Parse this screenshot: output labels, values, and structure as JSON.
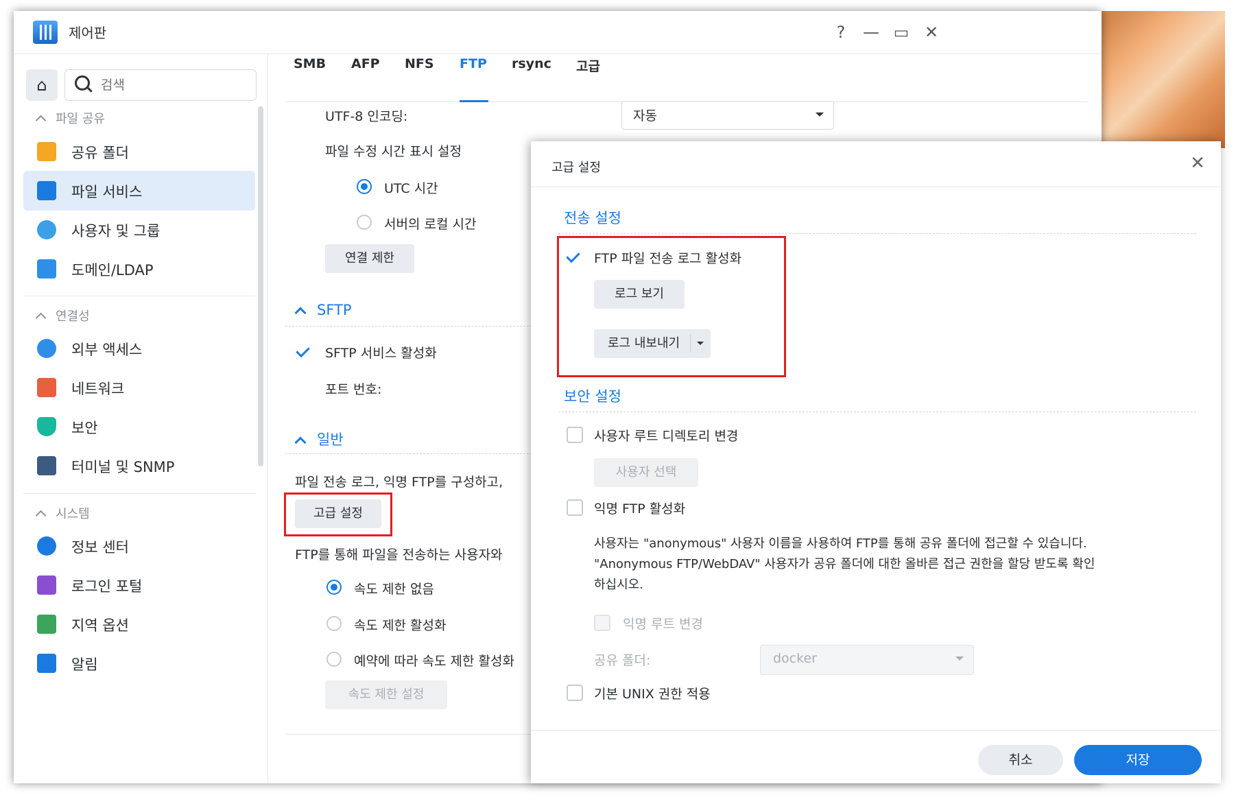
{
  "window": {
    "title": "제어판"
  },
  "window_buttons": {
    "help": "?",
    "minimize": "—",
    "maximize": "▭",
    "close": "✕"
  },
  "sidebar": {
    "search_placeholder": "검색",
    "sections": [
      {
        "title": "파일 공유",
        "items": [
          {
            "label": "공유 폴더",
            "icon": "folder-icon"
          },
          {
            "label": "파일 서비스",
            "icon": "file-services-icon",
            "active": true
          },
          {
            "label": "사용자 및 그룹",
            "icon": "users-icon"
          },
          {
            "label": "도메인/LDAP",
            "icon": "domain-icon"
          }
        ]
      },
      {
        "title": "연결성",
        "items": [
          {
            "label": "외부 액세스",
            "icon": "external-access-icon"
          },
          {
            "label": "네트워크",
            "icon": "network-icon"
          },
          {
            "label": "보안",
            "icon": "shield-icon"
          },
          {
            "label": "터미널 및 SNMP",
            "icon": "terminal-icon"
          }
        ]
      },
      {
        "title": "시스템",
        "items": [
          {
            "label": "정보 센터",
            "icon": "info-icon"
          },
          {
            "label": "로그인 포털",
            "icon": "login-portal-icon"
          },
          {
            "label": "지역 옵션",
            "icon": "region-icon"
          },
          {
            "label": "알림",
            "icon": "notification-icon"
          }
        ]
      }
    ]
  },
  "tabs": [
    "SMB",
    "AFP",
    "NFS",
    "FTP",
    "rsync",
    "고급"
  ],
  "active_tab": "FTP",
  "main": {
    "utf8_label": "UTF-8 인코딩:",
    "utf8_value": "자동",
    "mtime_label": "파일 수정 시간 표시 설정",
    "radio_utc": "UTC 시간",
    "radio_local": "서버의 로컬 시간",
    "conn_limit_button": "연결 제한",
    "sftp_title": "SFTP",
    "sftp_enable": "SFTP 서비스 활성화",
    "port_label": "포트 번호:",
    "general_title": "일반",
    "general_desc": "파일 전송 로그, 익명 FTP를 구성하고,",
    "advanced_button": "고급 설정",
    "speed_desc": "FTP를 통해 파일을 전송하는 사용자와",
    "speed_none": "속도 제한 없음",
    "speed_enable": "속도 제한 활성화",
    "speed_schedule": "예약에 따라 속도 제한 활성화",
    "speed_settings_button": "속도 제한 설정"
  },
  "dialog": {
    "title": "고급 설정",
    "transfer_section": "전송 설정",
    "ftp_log_enable": "FTP 파일 전송 로그 활성화",
    "view_log_button": "로그 보기",
    "export_log_button": "로그 내보내기",
    "security_section": "보안 설정",
    "change_user_root": "사용자 루트 디렉토리 변경",
    "select_user_button": "사용자 선택",
    "anon_ftp_enable": "익명 FTP 활성화",
    "anon_desc_1": "사용자는 \"anonymous\" 사용자 이름을 사용하여 FTP를 통해 공유 폴더에 접근할 수 있습니다.",
    "anon_desc_2": "\"Anonymous FTP/WebDAV\" 사용자가 공유 폴더에 대한 올바른 접근 권한을 할당 받도록 확인",
    "anon_desc_3": "하십시오.",
    "anon_root_change": "익명 루트 변경",
    "shared_folder_label": "공유 폴더:",
    "shared_folder_value": "docker",
    "unix_perm": "기본 UNIX 권한 적용",
    "cancel_button": "취소",
    "save_button": "저장"
  },
  "colors": {
    "accent": "#1a7ae0",
    "highlight": "#e02020",
    "active_bg": "#e1ecfa"
  }
}
